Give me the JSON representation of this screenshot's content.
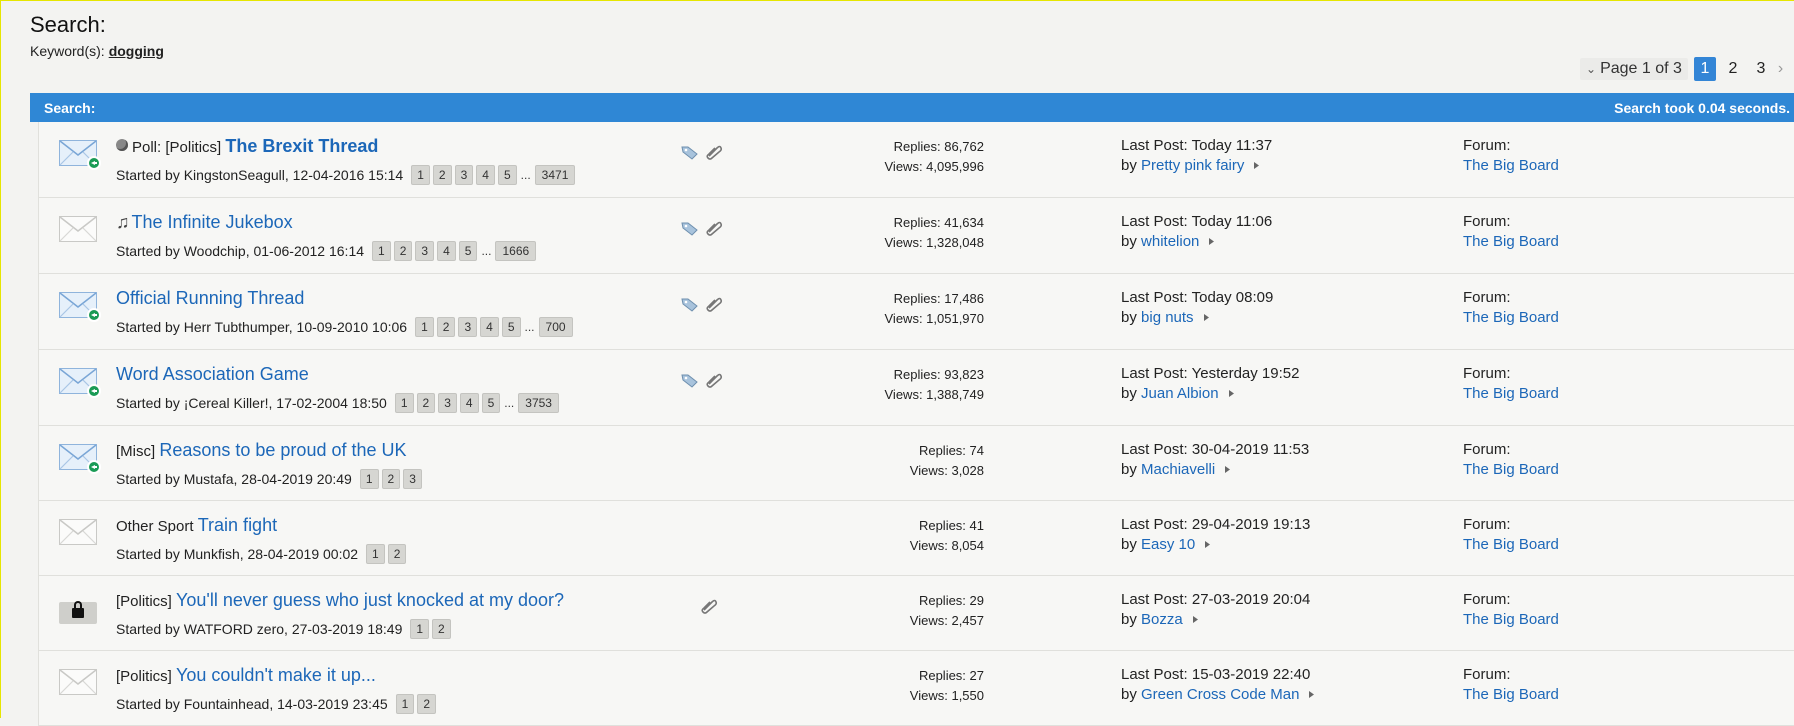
{
  "header": {
    "title": "Search:",
    "keywords_label": "Keyword(s):",
    "keyword": "dogging"
  },
  "pagination": {
    "label": "Page 1 of 3",
    "pages": [
      "1",
      "2",
      "3"
    ],
    "active": "1",
    "next": "›"
  },
  "search_bar": {
    "label": "Search:",
    "took": "Search took 0.04 seconds."
  },
  "threads": [
    {
      "icon": "envelope-new-icon",
      "prefix": "Poll: [Politics]",
      "title": "The Brexit Thread",
      "bold": true,
      "started": "Started by KingstonSeagull, 12-04-2016 15:14",
      "pages": [
        "1",
        "2",
        "3",
        "4",
        "5"
      ],
      "last_page": "3471",
      "replies": "Replies: 86,762",
      "views": "Views: 4,095,996",
      "lp_label": "Last Post: Today 11:37",
      "lp_by": "by",
      "lp_user": "Pretty pink fairy",
      "forum_label": "Forum:",
      "forum": "The Big Board",
      "has_tag": true,
      "has_clip": true
    },
    {
      "icon": "envelope-icon",
      "prefix": "",
      "title": "The Infinite Jukebox",
      "bold": false,
      "started": "Started by Woodchip, 01-06-2012 16:14",
      "pages": [
        "1",
        "2",
        "3",
        "4",
        "5"
      ],
      "last_page": "1666",
      "replies": "Replies: 41,634",
      "views": "Views: 1,328,048",
      "lp_label": "Last Post: Today 11:06",
      "lp_by": "by",
      "lp_user": "whitelion",
      "forum_label": "Forum:",
      "forum": "The Big Board",
      "has_tag": true,
      "has_clip": true
    },
    {
      "icon": "envelope-new-icon",
      "prefix": "",
      "title": "Official Running Thread",
      "bold": false,
      "started": "Started by Herr Tubthumper, 10-09-2010 10:06",
      "pages": [
        "1",
        "2",
        "3",
        "4",
        "5"
      ],
      "last_page": "700",
      "replies": "Replies: 17,486",
      "views": "Views: 1,051,970",
      "lp_label": "Last Post: Today 08:09",
      "lp_by": "by",
      "lp_user": "big nuts",
      "forum_label": "Forum:",
      "forum": "The Big Board",
      "has_tag": true,
      "has_clip": true
    },
    {
      "icon": "envelope-new-icon",
      "prefix": "",
      "title": "Word Association Game",
      "bold": false,
      "started": "Started by ¡Cereal Killer!, 17-02-2004 18:50",
      "pages": [
        "1",
        "2",
        "3",
        "4",
        "5"
      ],
      "last_page": "3753",
      "replies": "Replies: 93,823",
      "views": "Views: 1,388,749",
      "lp_label": "Last Post: Yesterday 19:52",
      "lp_by": "by",
      "lp_user": "Juan Albion",
      "forum_label": "Forum:",
      "forum": "The Big Board",
      "has_tag": true,
      "has_clip": true
    },
    {
      "icon": "envelope-new-icon",
      "prefix": "[Misc]",
      "title": "Reasons to be proud of the UK",
      "bold": false,
      "started": "Started by Mustafa, 28-04-2019 20:49",
      "pages": [
        "1",
        "2",
        "3"
      ],
      "last_page": "",
      "replies": "Replies: 74",
      "views": "Views: 3,028",
      "lp_label": "Last Post: 30-04-2019 11:53",
      "lp_by": "by",
      "lp_user": "Machiavelli",
      "forum_label": "Forum:",
      "forum": "The Big Board",
      "has_tag": false,
      "has_clip": false
    },
    {
      "icon": "envelope-icon",
      "prefix": "Other Sport",
      "title": "Train fight",
      "bold": false,
      "started": "Started by Munkfish, 28-04-2019 00:02",
      "pages": [
        "1",
        "2"
      ],
      "last_page": "",
      "replies": "Replies: 41",
      "views": "Views: 8,054",
      "lp_label": "Last Post: 29-04-2019 19:13",
      "lp_by": "by",
      "lp_user": "Easy 10",
      "forum_label": "Forum:",
      "forum": "The Big Board",
      "has_tag": false,
      "has_clip": false
    },
    {
      "icon": "lock-icon",
      "prefix": "[Politics]",
      "title": "You'll never guess who just knocked at my door?",
      "bold": false,
      "started": "Started by WATFORD zero, 27-03-2019 18:49",
      "pages": [
        "1",
        "2"
      ],
      "last_page": "",
      "replies": "Replies: 29",
      "views": "Views: 2,457",
      "lp_label": "Last Post: 27-03-2019 20:04",
      "lp_by": "by",
      "lp_user": "Bozza",
      "forum_label": "Forum:",
      "forum": "The Big Board",
      "has_tag": false,
      "has_clip": true
    },
    {
      "icon": "envelope-icon",
      "prefix": "[Politics]",
      "title": "You couldn't make it up...",
      "bold": false,
      "started": "Started by Fountainhead, 14-03-2019 23:45",
      "pages": [
        "1",
        "2"
      ],
      "last_page": "",
      "replies": "Replies: 27",
      "views": "Views: 1,550",
      "lp_label": "Last Post: 15-03-2019 22:40",
      "lp_by": "by",
      "lp_user": "Green Cross Code Man",
      "forum_label": "Forum:",
      "forum": "The Big Board",
      "has_tag": false,
      "has_clip": false
    }
  ]
}
